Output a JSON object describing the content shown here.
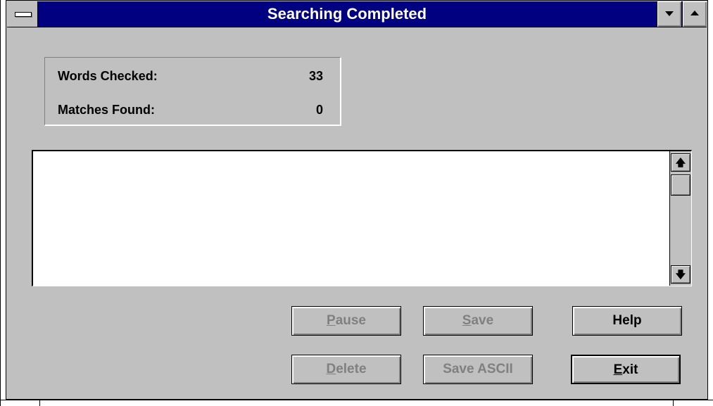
{
  "window": {
    "title": "Searching Completed"
  },
  "stats": {
    "words_checked_label": "Words Checked:",
    "words_checked_value": "33",
    "matches_found_label": "Matches Found:",
    "matches_found_value": "0"
  },
  "scrollbar": {
    "up_glyph": "🡅",
    "down_glyph": "🡇"
  },
  "buttons": {
    "pause": {
      "access_key": "P",
      "rest": "ause",
      "enabled": false
    },
    "save": {
      "access_key": "S",
      "rest": "ave",
      "enabled": false
    },
    "help": {
      "label": "Help",
      "enabled": true
    },
    "delete": {
      "access_key": "D",
      "rest": "elete",
      "enabled": false
    },
    "save_ascii": {
      "label": "Save ASCII",
      "enabled": false
    },
    "exit": {
      "access_key": "E",
      "rest": "xit",
      "enabled": true,
      "default": true
    }
  }
}
